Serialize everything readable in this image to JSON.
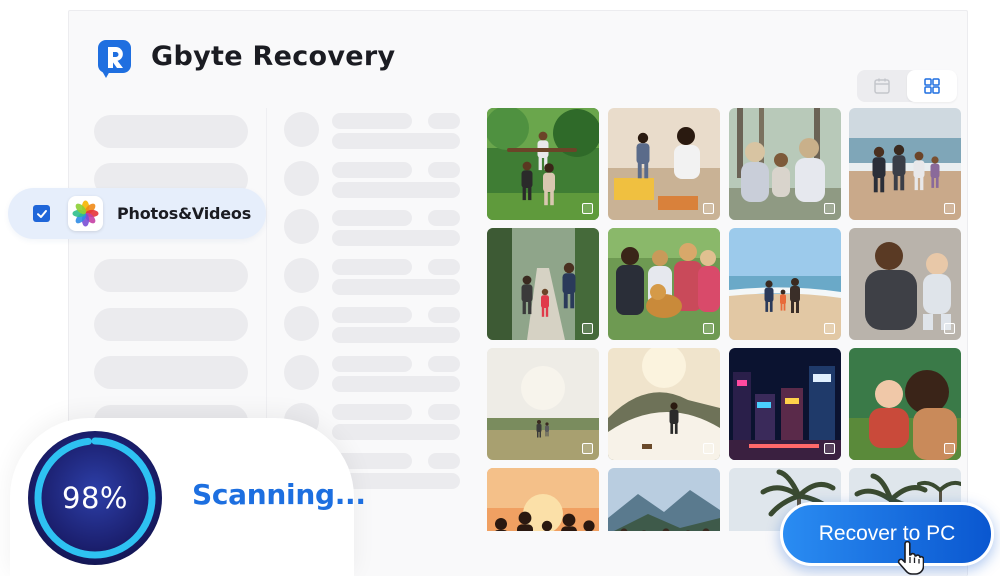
{
  "app": {
    "title": "Gbyte Recovery",
    "logo_icon": "gbyte-r-logo",
    "brand_color": "#1f6fe0"
  },
  "view_toggle": {
    "icons": [
      "calendar-icon",
      "grid-view-icon"
    ],
    "active": "grid-view-icon"
  },
  "category": {
    "label": "Photos&Videos",
    "checked": true,
    "icon": "photos-pinwheel-icon"
  },
  "photos": [
    {
      "name": "family-forest"
    },
    {
      "name": "mother-child-kitchen"
    },
    {
      "name": "family-woods-back"
    },
    {
      "name": "family-beach-back"
    },
    {
      "name": "family-path-walk"
    },
    {
      "name": "family-dog-park"
    },
    {
      "name": "family-beach-walk"
    },
    {
      "name": "father-baby-lying"
    },
    {
      "name": "field-sunset-walk"
    },
    {
      "name": "desert-dune-walk"
    },
    {
      "name": "city-night-street"
    },
    {
      "name": "mother-kissing-baby"
    },
    {
      "name": "group-sunset-silhouette"
    },
    {
      "name": "mountain-view-group"
    },
    {
      "name": "palm-trees-sky"
    },
    {
      "name": "palm-trees-sky-2"
    }
  ],
  "scan": {
    "progress_label": "98%",
    "progress": 0.98,
    "status": "Scanning..."
  },
  "actions": {
    "recover_label": "Recover to PC"
  },
  "colors": {
    "accent": "#1d6fe0",
    "button_start": "#2a8cf2",
    "button_end": "#0a57d0",
    "ring": "#2ec2f2"
  }
}
